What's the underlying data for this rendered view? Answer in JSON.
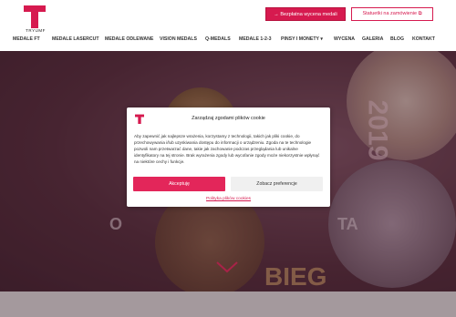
{
  "header": {
    "logo_text": "TRYUMF",
    "btn_primary": "→ Bezpłatna wycena medali",
    "btn_outline": "Statuetki na zamówienie ⧉"
  },
  "nav": {
    "items": [
      {
        "label": "MEDALE FT"
      },
      {
        "label": "MEDALE LASERCUT"
      },
      {
        "label": "MEDALE ODLEWANE"
      },
      {
        "label": "VISION MEDALS"
      },
      {
        "label": "Q-MEDALS"
      },
      {
        "label": "MEDALE 1-2-3"
      },
      {
        "label": "PINSY I MONETY ▾"
      },
      {
        "label": "WYCENA"
      },
      {
        "label": "GALERIA"
      },
      {
        "label": "BLOG"
      },
      {
        "label": "KONTAKT"
      }
    ]
  },
  "hero": {
    "title_left": "O",
    "title_right": "TA",
    "bieg": "BIEG",
    "year": "2019"
  },
  "modal": {
    "title": "Zarządzaj zgodami plików cookie",
    "text": "Aby zapewnić jak najlepsze wrażenia, korzystamy z technologii, takich jak pliki cookie, do przechowywania i/lub uzyskiwania dostępu do informacji o urządzeniu. Zgoda na te technologie pozwoli nam przetwarzać dane, takie jak zachowanie podczas przeglądania lub unikalne identyfikatory na tej stronie. Brak wyrażenia zgody lub wycofanie zgody może niekorzystnie wpłynąć na niektóre cechy i funkcje.",
    "accept": "Akceptuję",
    "prefs": "Zobacz preferencje",
    "policy": "Polityka plików cookies"
  },
  "colors": {
    "accent": "#d61a4f"
  }
}
